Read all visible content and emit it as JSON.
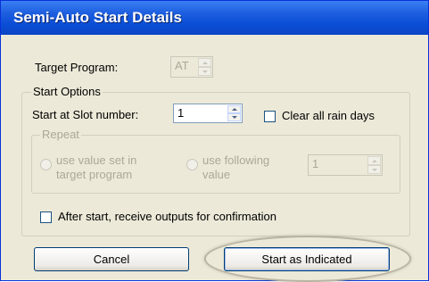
{
  "window": {
    "title": "Semi-Auto Start Details"
  },
  "target_program": {
    "label": "Target Program:",
    "value": "AT"
  },
  "start_options": {
    "legend": "Start Options",
    "slot_label": "Start at Slot number:",
    "slot_value": "1",
    "clear_rain_label": "Clear all rain days",
    "clear_rain_checked": false
  },
  "repeat": {
    "legend": "Repeat",
    "option_target": "use value set in target program",
    "option_following": "use following value",
    "value": "1"
  },
  "confirm": {
    "label": "After start, receive outputs for confirmation",
    "checked": false
  },
  "buttons": {
    "cancel": "Cancel",
    "start": "Start as Indicated"
  }
}
